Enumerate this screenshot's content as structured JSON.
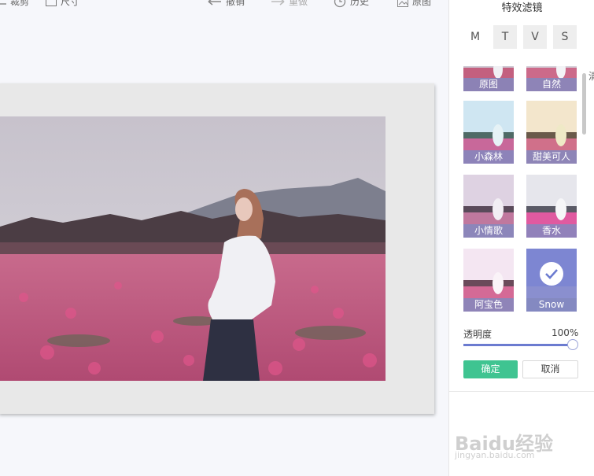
{
  "toolbar": {
    "crop_label": "裁剪",
    "size_label": "尺寸",
    "undo_label": "撤销",
    "redo_label": "重做",
    "history_label": "历史",
    "original_label": "原图"
  },
  "panel": {
    "title": "特效滤镜",
    "tabs": [
      "M",
      "T",
      "V",
      "S"
    ],
    "filters": [
      {
        "label": "原图"
      },
      {
        "label": "自然"
      },
      {
        "label": "小森林"
      },
      {
        "label": "甜美可人"
      },
      {
        "label": "小情歌"
      },
      {
        "label": "香水"
      },
      {
        "label": "阿宝色"
      },
      {
        "label": "Snow",
        "selected": true
      }
    ],
    "opacity_label": "透明度",
    "opacity_value": "100%",
    "opacity_level": 1.0,
    "confirm_label": "确定",
    "cancel_label": "取消",
    "partial_side_text": "清"
  },
  "watermark": {
    "brand": "Baidu经验",
    "url": "jingyan.baidu.com"
  },
  "colors": {
    "accent": "#6b7bd0",
    "confirm": "#3fc491",
    "thumb_label_bg": "#8288be"
  }
}
